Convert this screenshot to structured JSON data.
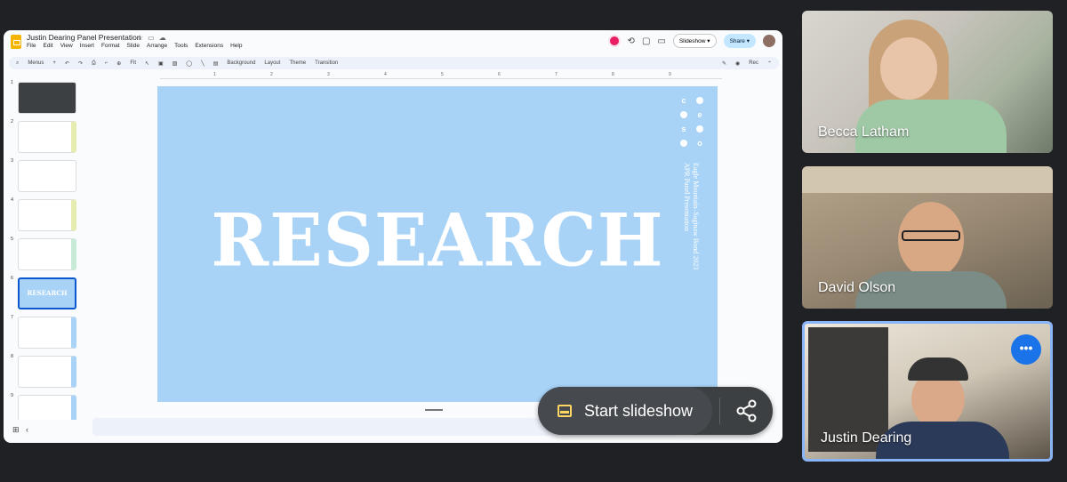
{
  "doc": {
    "title": "Justin Dearing Panel Presentation",
    "menu": [
      "File",
      "Edit",
      "View",
      "Insert",
      "Format",
      "Slide",
      "Arrange",
      "Tools",
      "Extensions",
      "Help"
    ],
    "slideshow_label": "Slideshow",
    "share_label": "Share"
  },
  "toolbar": {
    "menus_label": "Menus",
    "zoom_label": "Fit",
    "background_label": "Background",
    "layout_label": "Layout",
    "theme_label": "Theme",
    "transition_label": "Transition",
    "rec_label": "Rec"
  },
  "ruler": [
    "1",
    "2",
    "3",
    "4",
    "5",
    "6",
    "7",
    "8",
    "9"
  ],
  "thumbnails": [
    {
      "num": "1"
    },
    {
      "num": "2"
    },
    {
      "num": "3"
    },
    {
      "num": "4"
    },
    {
      "num": "5"
    },
    {
      "num": "6",
      "label": "RESEARCH"
    },
    {
      "num": "7"
    },
    {
      "num": "8"
    },
    {
      "num": "9"
    }
  ],
  "slide": {
    "title": "RESEARCH",
    "logo_letters": [
      "c",
      "e",
      "s",
      "o"
    ],
    "vertical_line1": "Eagle Mountain–Saginaw Bond 2023",
    "vertical_line2": "APR Panel Presentation"
  },
  "toast": {
    "start_label": "Start slideshow"
  },
  "participants": [
    {
      "name": "Becca Latham"
    },
    {
      "name": "David Olson"
    },
    {
      "name": "Justin Dearing"
    }
  ],
  "colors": {
    "slide_bg": "#a8d3f7",
    "accent": "#1a73e8",
    "active_tile_border": "#8ab4f8"
  }
}
